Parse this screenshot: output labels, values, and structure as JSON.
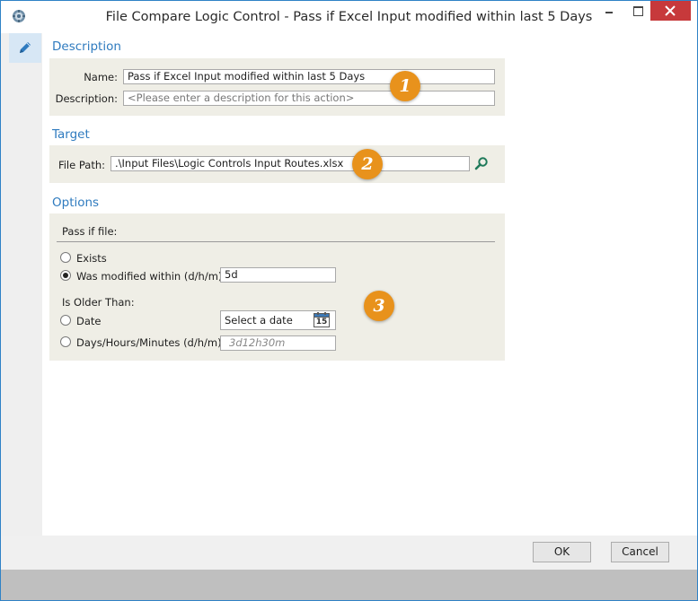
{
  "window": {
    "title": "File Compare Logic Control - Pass if Excel Input modified within last 5 Days"
  },
  "description": {
    "section_title": "Description",
    "name_label": "Name:",
    "name_value": "Pass if Excel Input modified within last 5 Days",
    "description_label": "Description:",
    "description_placeholder": "<Please enter a description for this action>"
  },
  "target": {
    "section_title": "Target",
    "file_path_label": "File Path:",
    "file_path_value": ".\\Input Files\\Logic Controls Input Routes.xlsx"
  },
  "options": {
    "section_title": "Options",
    "pass_if_file_label": "Pass if file:",
    "exists_label": "Exists",
    "modified_within_label": "Was modified within (d/h/m)",
    "modified_within_value": "5d",
    "is_older_than_label": "Is Older Than:",
    "date_label": "Date",
    "date_placeholder": "Select a date",
    "calendar_day": "15",
    "dhm_label": "Days/Hours/Minutes (d/h/m)",
    "dhm_placeholder": "3d12h30m"
  },
  "badges": [
    "1",
    "2",
    "3"
  ],
  "buttons": {
    "ok": "OK",
    "cancel": "Cancel"
  },
  "colors": {
    "accent": "#2f7bbf",
    "badge": "#e8921c",
    "close_button": "#c7393b",
    "panel": "#efeee6"
  }
}
